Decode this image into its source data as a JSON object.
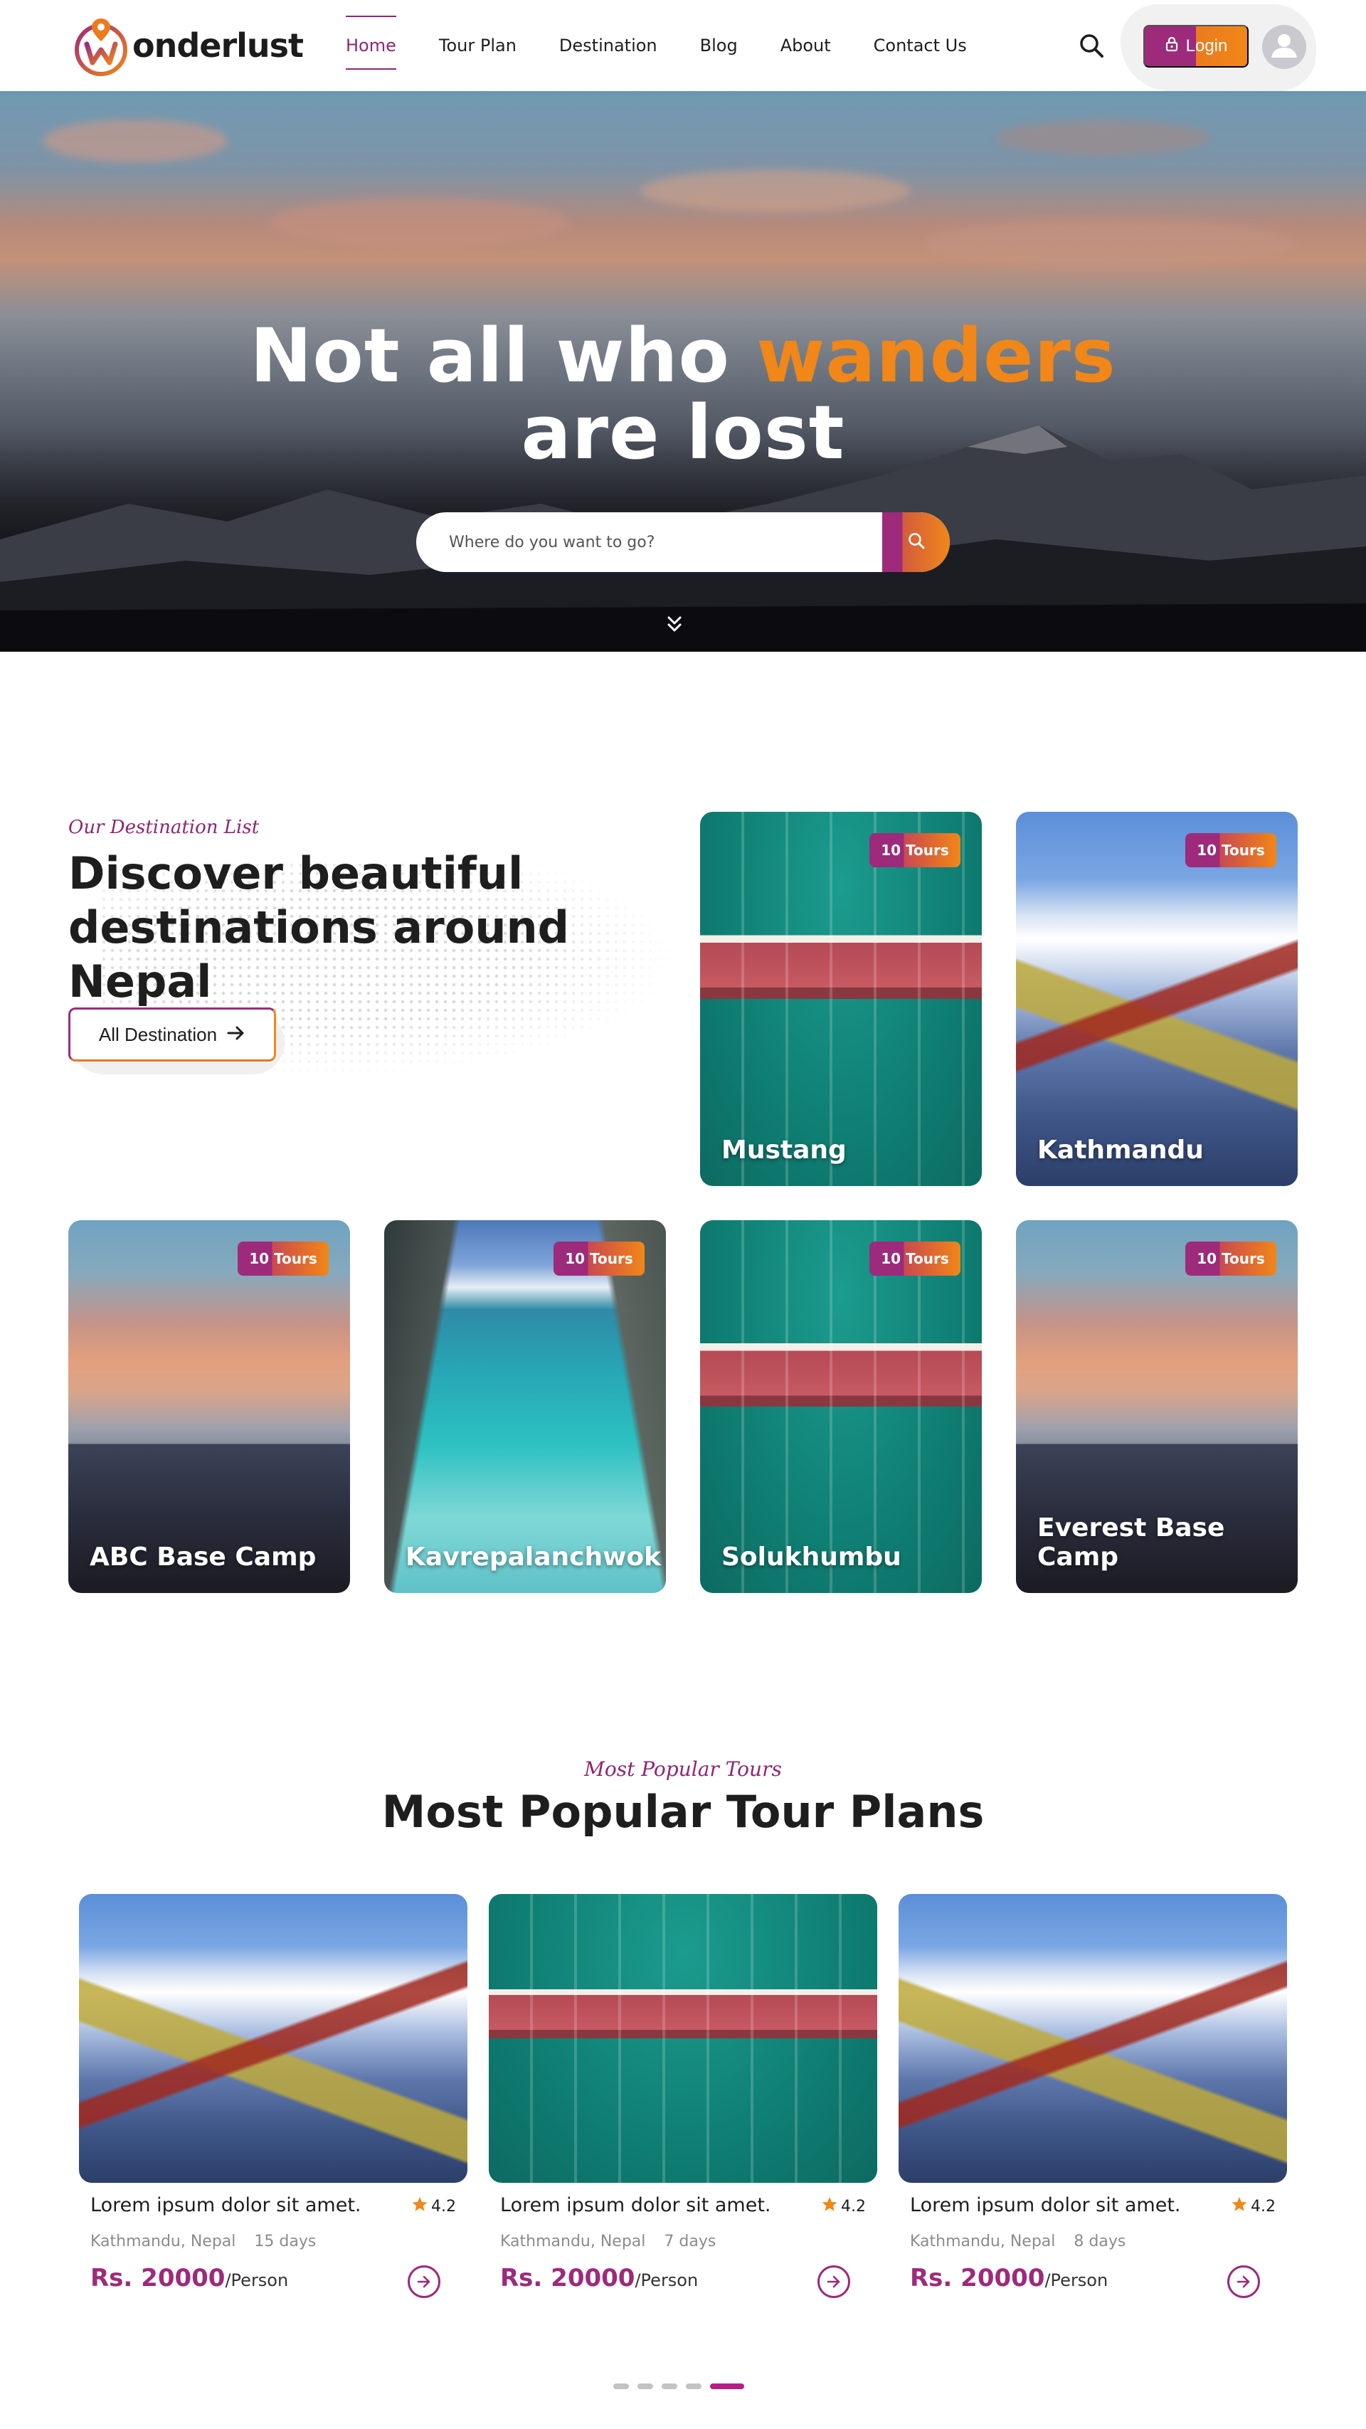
{
  "brand": {
    "logo_text": "onderlust",
    "logo_letter": "W",
    "primary_color": "#9d2a7b",
    "accent_color": "#f08718"
  },
  "nav": {
    "items": [
      {
        "label": "Home",
        "active": true
      },
      {
        "label": "Tour Plan",
        "active": false
      },
      {
        "label": "Destination",
        "active": false
      },
      {
        "label": "Blog",
        "active": false
      },
      {
        "label": "About",
        "active": false
      },
      {
        "label": "Contact Us",
        "active": false
      }
    ],
    "search_icon": "search-icon",
    "login_label": "Login",
    "login_icon": "lock-icon",
    "avatar_icon": "user-icon"
  },
  "hero": {
    "title_part1": "Not all who ",
    "title_accent": "wanders",
    "title_part2": "are lost",
    "search_placeholder": "Where do you want to go?",
    "search_icon": "search-icon",
    "scroll_icon": "double-chevron-down-icon"
  },
  "destinations": {
    "eyebrow": "Our Destination List",
    "title": "Discover beautiful destinations around Nepal",
    "button_label": "All Destination",
    "button_icon": "arrow-right-icon",
    "cards": [
      {
        "name": "Mustang",
        "badge": "10 Tours",
        "image": "resort"
      },
      {
        "name": "Kathmandu",
        "badge": "10 Tours",
        "image": "everest"
      },
      {
        "name": "ABC Base Camp",
        "badge": "10 Tours",
        "image": "sunset"
      },
      {
        "name": "Kavrepalanchwok",
        "badge": "10 Tours",
        "image": "lagoon"
      },
      {
        "name": "Solukhumbu",
        "badge": "10 Tours",
        "image": "resort"
      },
      {
        "name": "Everest Base Camp",
        "badge": "10 Tours",
        "image": "sunset"
      }
    ]
  },
  "popular": {
    "eyebrow": "Most Popular Tours",
    "title": "Most Popular Tour Plans",
    "tours": [
      {
        "title": "Lorem ipsum dolor sit amet.",
        "rating": "4.2",
        "location": "Kathmandu, Nepal",
        "duration": "15 days",
        "price": "Rs. 20000",
        "per": "/Person",
        "image": "everest"
      },
      {
        "title": "Lorem ipsum dolor sit amet.",
        "rating": "4.2",
        "location": "Kathmandu, Nepal",
        "duration": "7 days",
        "price": "Rs. 20000",
        "per": "/Person",
        "image": "resort"
      },
      {
        "title": "Lorem ipsum dolor sit amet.",
        "rating": "4.2",
        "location": "Kathmandu, Nepal",
        "duration": "8 days",
        "price": "Rs. 20000",
        "per": "/Person",
        "image": "everest"
      }
    ],
    "pagination": {
      "count": 5,
      "active_index": 4
    }
  }
}
